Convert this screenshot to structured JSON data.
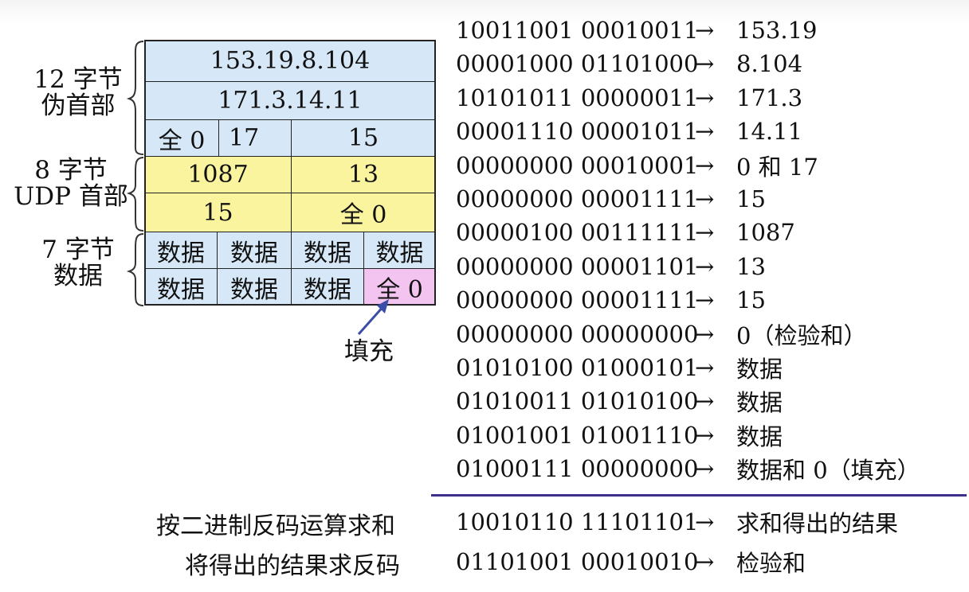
{
  "left_labels": {
    "pseudo_header": [
      "12 字节",
      "伪首部"
    ],
    "udp_header": [
      "8 字节",
      "UDP 首部"
    ],
    "data": [
      "7 字节",
      "数据"
    ]
  },
  "packet": {
    "src_ip": "153.19.8.104",
    "dst_ip": "171.3.14.11",
    "zero": "全 0",
    "protocol": "17",
    "udp_length": "15",
    "src_port": "1087",
    "dst_port": "13",
    "length": "15",
    "checksum": "全 0",
    "data_cells": [
      "数据",
      "数据",
      "数据",
      "数据",
      "数据",
      "数据",
      "数据"
    ],
    "padding": "全 0",
    "padding_label": "填充"
  },
  "rows": [
    {
      "bits": "10011001 00010011",
      "arrow": "→",
      "result": "153.19"
    },
    {
      "bits": "00001000 01101000",
      "arrow": "→",
      "result": "8.104"
    },
    {
      "bits": "10101011 00000011",
      "arrow": "→",
      "result": "171.3"
    },
    {
      "bits": "00001110 00001011",
      "arrow": "→",
      "result": "14.11"
    },
    {
      "bits": "00000000 00010001",
      "arrow": "→",
      "result": "0 和 17"
    },
    {
      "bits": "00000000 00001111",
      "arrow": "→",
      "result": "15"
    },
    {
      "bits": "00000100 00111111",
      "arrow": "→",
      "result": "1087"
    },
    {
      "bits": "00000000 00001101",
      "arrow": "→",
      "result": "13"
    },
    {
      "bits": "00000000 00001111",
      "arrow": "→",
      "result": "15"
    },
    {
      "bits": "00000000 00000000",
      "arrow": "→",
      "result": "0（检验和）"
    },
    {
      "bits": "01010100 01000101",
      "arrow": "→",
      "result": "数据"
    },
    {
      "bits": "01010011 01010100",
      "arrow": "→",
      "result": "数据"
    },
    {
      "bits": "01001001 01001110",
      "arrow": "→",
      "result": "数据"
    },
    {
      "bits": "01000111 00000000",
      "arrow": "→",
      "result": "数据和 0（填充）"
    }
  ],
  "sum": {
    "label": "按二进制反码运算求和",
    "bits": "10010110 11101101",
    "arrow": "→",
    "result": "求和得出的结果"
  },
  "complement": {
    "label": "将得出的结果求反码",
    "bits": "01101001 00010010",
    "arrow": "→",
    "result": "检验和"
  },
  "colors": {
    "pseudo_header": "#d6e8f7",
    "udp_header": "#fbf49f",
    "padding": "#f2c4ef",
    "divider": "#3e2f8c",
    "arrow": "#3a4ea8"
  }
}
